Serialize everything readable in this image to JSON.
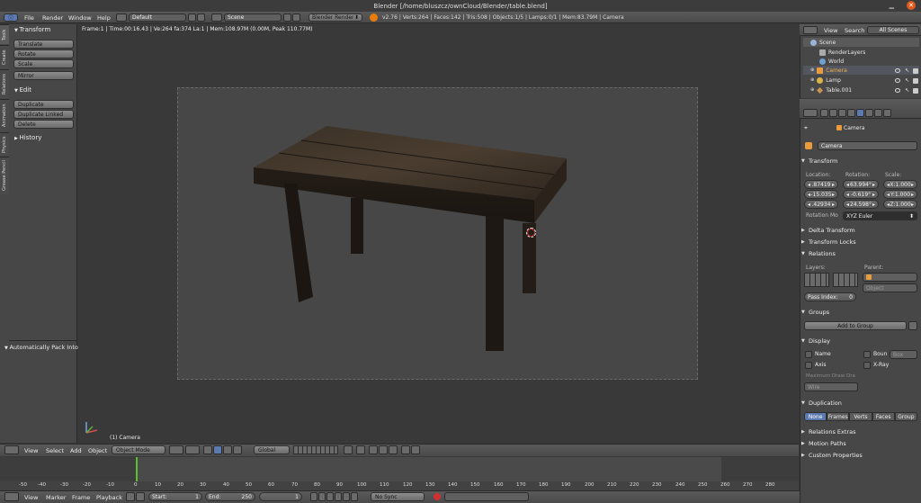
{
  "window": {
    "title": "Blender [/home/bluszcz/ownCloud/Blender/table.blend]"
  },
  "menubar": {
    "items": [
      "File",
      "Render",
      "Window",
      "Help"
    ],
    "layout": "Default",
    "scene": "Scene",
    "engine": "Blender Render",
    "stats": "v2.76 | Verts:264 | Faces:142 | Tris:508 | Objects:1/5 | Lamps:0/1 | Mem:83.79M | Camera"
  },
  "tool_shelf": {
    "tabs": [
      "Tools",
      "Create",
      "Relations",
      "Animation",
      "Physics",
      "Grease Pencil"
    ],
    "transform_header": "Transform",
    "transform_buttons": [
      "Translate",
      "Rotate",
      "Scale"
    ],
    "mirror": "Mirror",
    "edit_header": "Edit",
    "edit_buttons": [
      "Duplicate",
      "Duplicate Linked",
      "Delete"
    ],
    "history_header": "History",
    "operator_panel": "Automatically Pack Into"
  },
  "viewport": {
    "info": "Frame:1 | Time:00:16.43 | Ve:264 fa:374 La:1 | Mem:108.97M (0.00M, Peak 110.77M)",
    "object_label": "(1) Camera"
  },
  "view3d_header": {
    "menus": [
      "View",
      "Select",
      "Add",
      "Object"
    ],
    "mode": "Object Mode",
    "orientation": "Global"
  },
  "outliner": {
    "menus": [
      "View",
      "Search"
    ],
    "filter": "All Scenes",
    "tree": [
      "Scene",
      "RenderLayers",
      "World",
      "Camera",
      "Lamp",
      "Table.001"
    ]
  },
  "properties": {
    "breadcrumb": "Camera",
    "object_name": "Camera",
    "transform": {
      "header": "Transform",
      "location_label": "Location:",
      "rotation_label": "Rotation:",
      "scale_label": "Scale:",
      "location": [
        ".87419",
        "-15.035",
        ".42934"
      ],
      "rotation": [
        "63.994°",
        "-0.619°",
        "24.598°"
      ],
      "scale": [
        "X:1.000",
        "Y:1.000",
        "Z:1.000"
      ],
      "rotation_mode_label": "Rotation Mo",
      "rotation_mode": "XYZ Euler"
    },
    "delta_transform": "Delta Transform",
    "transform_locks": "Transform Locks",
    "relations": {
      "header": "Relations",
      "layers_label": "Layers:",
      "parent_label": "Parent:",
      "parent_type": "Object",
      "pass_index_label": "Pass Index:",
      "pass_index": "0"
    },
    "groups": {
      "header": "Groups",
      "add_button": "Add to Group"
    },
    "display": {
      "header": "Display",
      "name": "Name",
      "axis": "Axis",
      "bounds": "Boun",
      "bounds_type": "Box",
      "xray": "X-Ray",
      "max_draw_label": "Maximum Draw Dra",
      "max_draw": "Wire"
    },
    "duplication": {
      "header": "Duplication",
      "options": [
        "None",
        "Frames",
        "Verts",
        "Faces",
        "Group"
      ]
    },
    "collapsed": [
      "Relations Extras",
      "Motion Paths",
      "Custom Properties"
    ]
  },
  "timeline": {
    "ticks": [
      "-50",
      "-40",
      "-30",
      "-20",
      "-10",
      "0",
      "10",
      "20",
      "30",
      "40",
      "50",
      "60",
      "70",
      "80",
      "90",
      "100",
      "110",
      "120",
      "130",
      "140",
      "150",
      "160",
      "170",
      "180",
      "190",
      "200",
      "210",
      "220",
      "230",
      "240",
      "250",
      "260",
      "270",
      "280"
    ],
    "menus": [
      "View",
      "Marker",
      "Frame",
      "Playback"
    ],
    "start_label": "Start:",
    "start": "1",
    "end_label": "End:",
    "end": "250",
    "current": "1",
    "sync": "No Sync"
  }
}
